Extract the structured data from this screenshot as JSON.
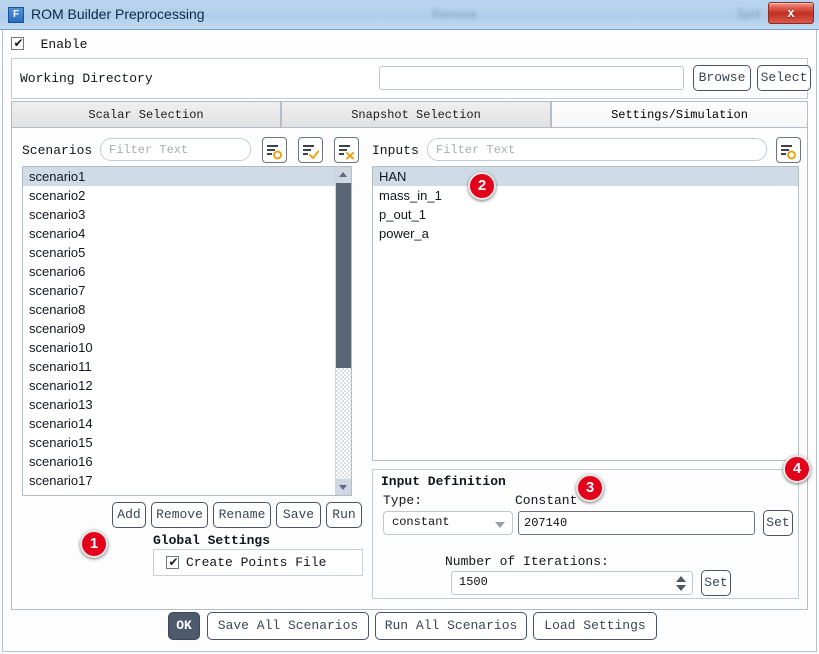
{
  "window": {
    "title": "ROM Builder Preprocessing",
    "icon": "app-icon",
    "icon_glyph": "F",
    "close_label": "x",
    "ghost_text_left": "Remove",
    "ghost_text_right": "Split"
  },
  "enable": {
    "label": "Enable",
    "checked": true
  },
  "working_directory": {
    "label": "Working Directory",
    "value": "",
    "placeholder": "",
    "browse_label": "Browse",
    "select_label": "Select"
  },
  "tabs": {
    "active_index": 2,
    "items": [
      {
        "label": "Scalar Selection"
      },
      {
        "label": "Snapshot Selection"
      },
      {
        "label": "Settings/Simulation"
      }
    ]
  },
  "scenarios": {
    "label": "Scenarios",
    "filter_placeholder": "Filter Text",
    "filter_value": "",
    "icon_buttons": [
      {
        "name": "select-none-icon",
        "glyph": "list-circle"
      },
      {
        "name": "select-all-icon",
        "glyph": "list-check"
      },
      {
        "name": "clear-selection-icon",
        "glyph": "list-x"
      }
    ],
    "selected_index": 0,
    "items": [
      "scenario1",
      "scenario2",
      "scenario3",
      "scenario4",
      "scenario5",
      "scenario6",
      "scenario7",
      "scenario8",
      "scenario9",
      "scenario10",
      "scenario11",
      "scenario12",
      "scenario13",
      "scenario14",
      "scenario15",
      "scenario16",
      "scenario17"
    ],
    "actions": [
      {
        "label": "Add"
      },
      {
        "label": "Remove"
      },
      {
        "label": "Rename"
      },
      {
        "label": "Save"
      },
      {
        "label": "Run"
      }
    ]
  },
  "global_settings": {
    "title": "Global Settings",
    "create_points_file": {
      "label": "Create Points File",
      "checked": true
    }
  },
  "inputs": {
    "label": "Inputs",
    "filter_placeholder": "Filter Text",
    "filter_value": "",
    "icon_button": {
      "name": "select-none-icon",
      "glyph": "list-circle"
    },
    "selected_index": 0,
    "items": [
      "HAN",
      "mass_in_1",
      "p_out_1",
      "power_a"
    ]
  },
  "input_definition": {
    "title": "Input Definition",
    "type_label": "Type:",
    "type_value": "constant",
    "type_options": [
      "constant"
    ],
    "constant_label": "Constant",
    "constant_value": "207140",
    "set_label_1": "Set",
    "iterations_label": "Number of Iterations:",
    "iterations_value": "1500",
    "set_label_2": "Set"
  },
  "bottom_bar": {
    "ok_label": "OK",
    "save_all_label": "Save All Scenarios",
    "run_all_label": "Run All Scenarios",
    "load_settings_label": "Load Settings"
  },
  "annotations": [
    {
      "number": "1"
    },
    {
      "number": "2"
    },
    {
      "number": "3"
    },
    {
      "number": "4"
    }
  ],
  "colors": {
    "badge_red": "#e2001a",
    "title_blue": "#b3d0ec",
    "selection_blue": "#cfdce8",
    "icon_orange": "#e8a317",
    "ok_dark": "#4d5a6b"
  }
}
